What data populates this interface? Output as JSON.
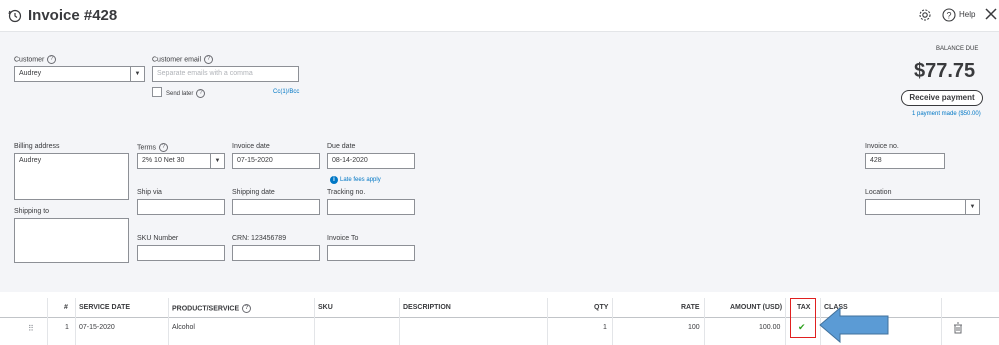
{
  "header": {
    "title": "Invoice #428",
    "help_label": "Help"
  },
  "customer": {
    "label": "Customer",
    "value": "Audrey"
  },
  "customer_email": {
    "label": "Customer email",
    "placeholder": "Separate emails with a comma",
    "send_later_label": "Send later",
    "cc_bcc_link": "Cc(1)/Bcc"
  },
  "balance": {
    "label": "BALANCE DUE",
    "amount": "$77.75",
    "receive_payment_label": "Receive payment",
    "payment_made_link": "1 payment made ($50.00)"
  },
  "billing": {
    "label": "Billing address",
    "value": "Audrey"
  },
  "shipping": {
    "label": "Shipping to",
    "value": ""
  },
  "terms": {
    "label": "Terms",
    "value": "2% 10 Net 30"
  },
  "invoice_date": {
    "label": "Invoice date",
    "value": "07-15-2020"
  },
  "due_date": {
    "label": "Due date",
    "value": "08-14-2020",
    "late_fees_label": "Late fees apply"
  },
  "ship_via": {
    "label": "Ship via",
    "value": ""
  },
  "shipping_date": {
    "label": "Shipping date",
    "value": ""
  },
  "tracking_no": {
    "label": "Tracking no.",
    "value": ""
  },
  "sku_number": {
    "label": "SKU Number",
    "value": ""
  },
  "crn": {
    "label": "CRN: 123456789",
    "value": ""
  },
  "invoice_to": {
    "label": "Invoice To",
    "value": ""
  },
  "invoice_no": {
    "label": "Invoice no.",
    "value": "428"
  },
  "location": {
    "label": "Location",
    "value": ""
  },
  "table": {
    "headers": {
      "num": "#",
      "service_date": "SERVICE DATE",
      "product_service": "PRODUCT/SERVICE",
      "sku": "SKU",
      "description": "DESCRIPTION",
      "qty": "QTY",
      "rate": "RATE",
      "amount": "AMOUNT (USD)",
      "tax": "TAX",
      "class": "CLASS"
    },
    "rows": [
      {
        "num": "1",
        "service_date": "07-15-2020",
        "product_service": "Alcohol",
        "sku": "",
        "description": "",
        "qty": "1",
        "rate": "100",
        "amount": "100.00",
        "tax": "✔"
      }
    ]
  },
  "colors": {
    "accent_green": "#2ca01c",
    "link_blue": "#0077c5",
    "highlight_red": "#e02020",
    "arrow_blue": "#5b9bd5"
  }
}
